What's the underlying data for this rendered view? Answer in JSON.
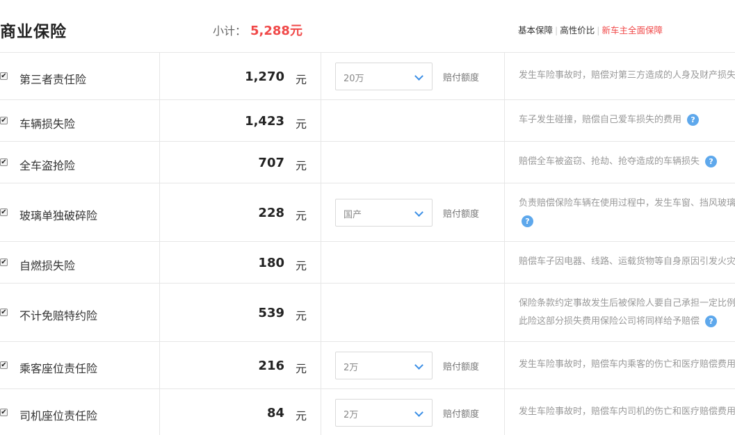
{
  "header": {
    "title": "商业保险",
    "subtotal_label": "小计：",
    "subtotal_amount": "5,288元",
    "plans": [
      "基本保障",
      "高性价比",
      "新车主全面保障"
    ]
  },
  "rows": [
    {
      "name": "第三者责任险",
      "price": "1,270",
      "unit": "元",
      "select_value": "20万",
      "limit_label": "赔付额度",
      "desc": "发生车险事故时，赔偿对第三方造成的人身及财产损失"
    },
    {
      "name": "车辆损失险",
      "price": "1,423",
      "unit": "元",
      "desc": "车子发生碰撞，赔偿自己爱车损失的费用"
    },
    {
      "name": "全车盗抢险",
      "price": "707",
      "unit": "元",
      "desc": "赔偿全车被盗窃、抢劫、抢夺造成的车辆损失"
    },
    {
      "name": "玻璃单独破碎险",
      "price": "228",
      "unit": "元",
      "select_value": "国产",
      "limit_label": "赔付额度",
      "desc": "负责赔偿保险车辆在使用过程中，发生车窗、挡风玻璃"
    },
    {
      "name": "自燃损失险",
      "price": "180",
      "unit": "元",
      "desc": "赔偿车子因电器、线路、运载货物等自身原因引发火灾"
    },
    {
      "name": "不计免赔特约险",
      "price": "539",
      "unit": "元",
      "desc": "保险条款约定事故发生后被保险人要自己承担一定比例",
      "desc2": "此险这部分损失费用保险公司将同样给予赔偿"
    },
    {
      "name": "乘客座位责任险",
      "price": "216",
      "unit": "元",
      "select_value": "2万",
      "limit_label": "赔付额度",
      "desc": "发生车险事故时，赔偿车内乘客的伤亡和医疗赔偿费用"
    },
    {
      "name": "司机座位责任险",
      "price": "84",
      "unit": "元",
      "select_value": "2万",
      "limit_label": "赔付额度",
      "desc": "发生车险事故时，赔偿车内司机的伤亡和医疗赔偿费用"
    }
  ],
  "icons": {
    "checkbox": "checkmark-icon",
    "chevron": "chevron-down-icon",
    "help": "question-icon"
  },
  "colors": {
    "accent_red": "#f04848",
    "blue": "#5ea8ec"
  }
}
